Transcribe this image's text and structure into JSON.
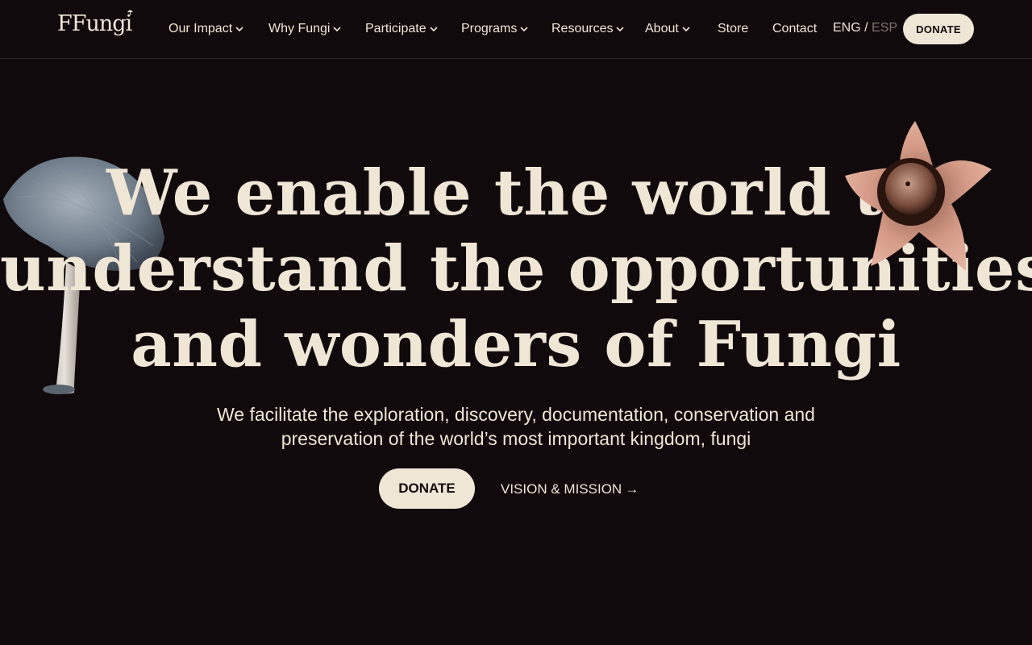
{
  "header": {
    "logo": "FFungi",
    "nav": [
      {
        "label": "Our Impact",
        "has_dropdown": true
      },
      {
        "label": "Why Fungi",
        "has_dropdown": true
      },
      {
        "label": "Participate",
        "has_dropdown": true
      },
      {
        "label": "Programs",
        "has_dropdown": true
      },
      {
        "label": "Resources",
        "has_dropdown": true
      },
      {
        "label": "About",
        "has_dropdown": true
      },
      {
        "label": "Store",
        "has_dropdown": false
      },
      {
        "label": "Contact",
        "has_dropdown": false
      }
    ],
    "lang_active": "ENG",
    "lang_sep": "/",
    "lang_inactive": "ESP",
    "donate_label": "DONATE"
  },
  "hero": {
    "title_lines": [
      "We enable the world to",
      "understand the opportunities",
      "and wonders of Fungi"
    ],
    "subtitle_lines": [
      "We facilitate the exploration, discovery, documentation, conservation and",
      "preservation of the world’s most important kingdom, fungi"
    ],
    "donate_label": "DONATE",
    "vision_label": "VISION & MISSION",
    "vision_arrow": "→"
  },
  "colors": {
    "background": "#110a0c",
    "text": "#efe6d6",
    "button_bg": "#efe6d6",
    "inactive_lang": "#7a7272"
  }
}
